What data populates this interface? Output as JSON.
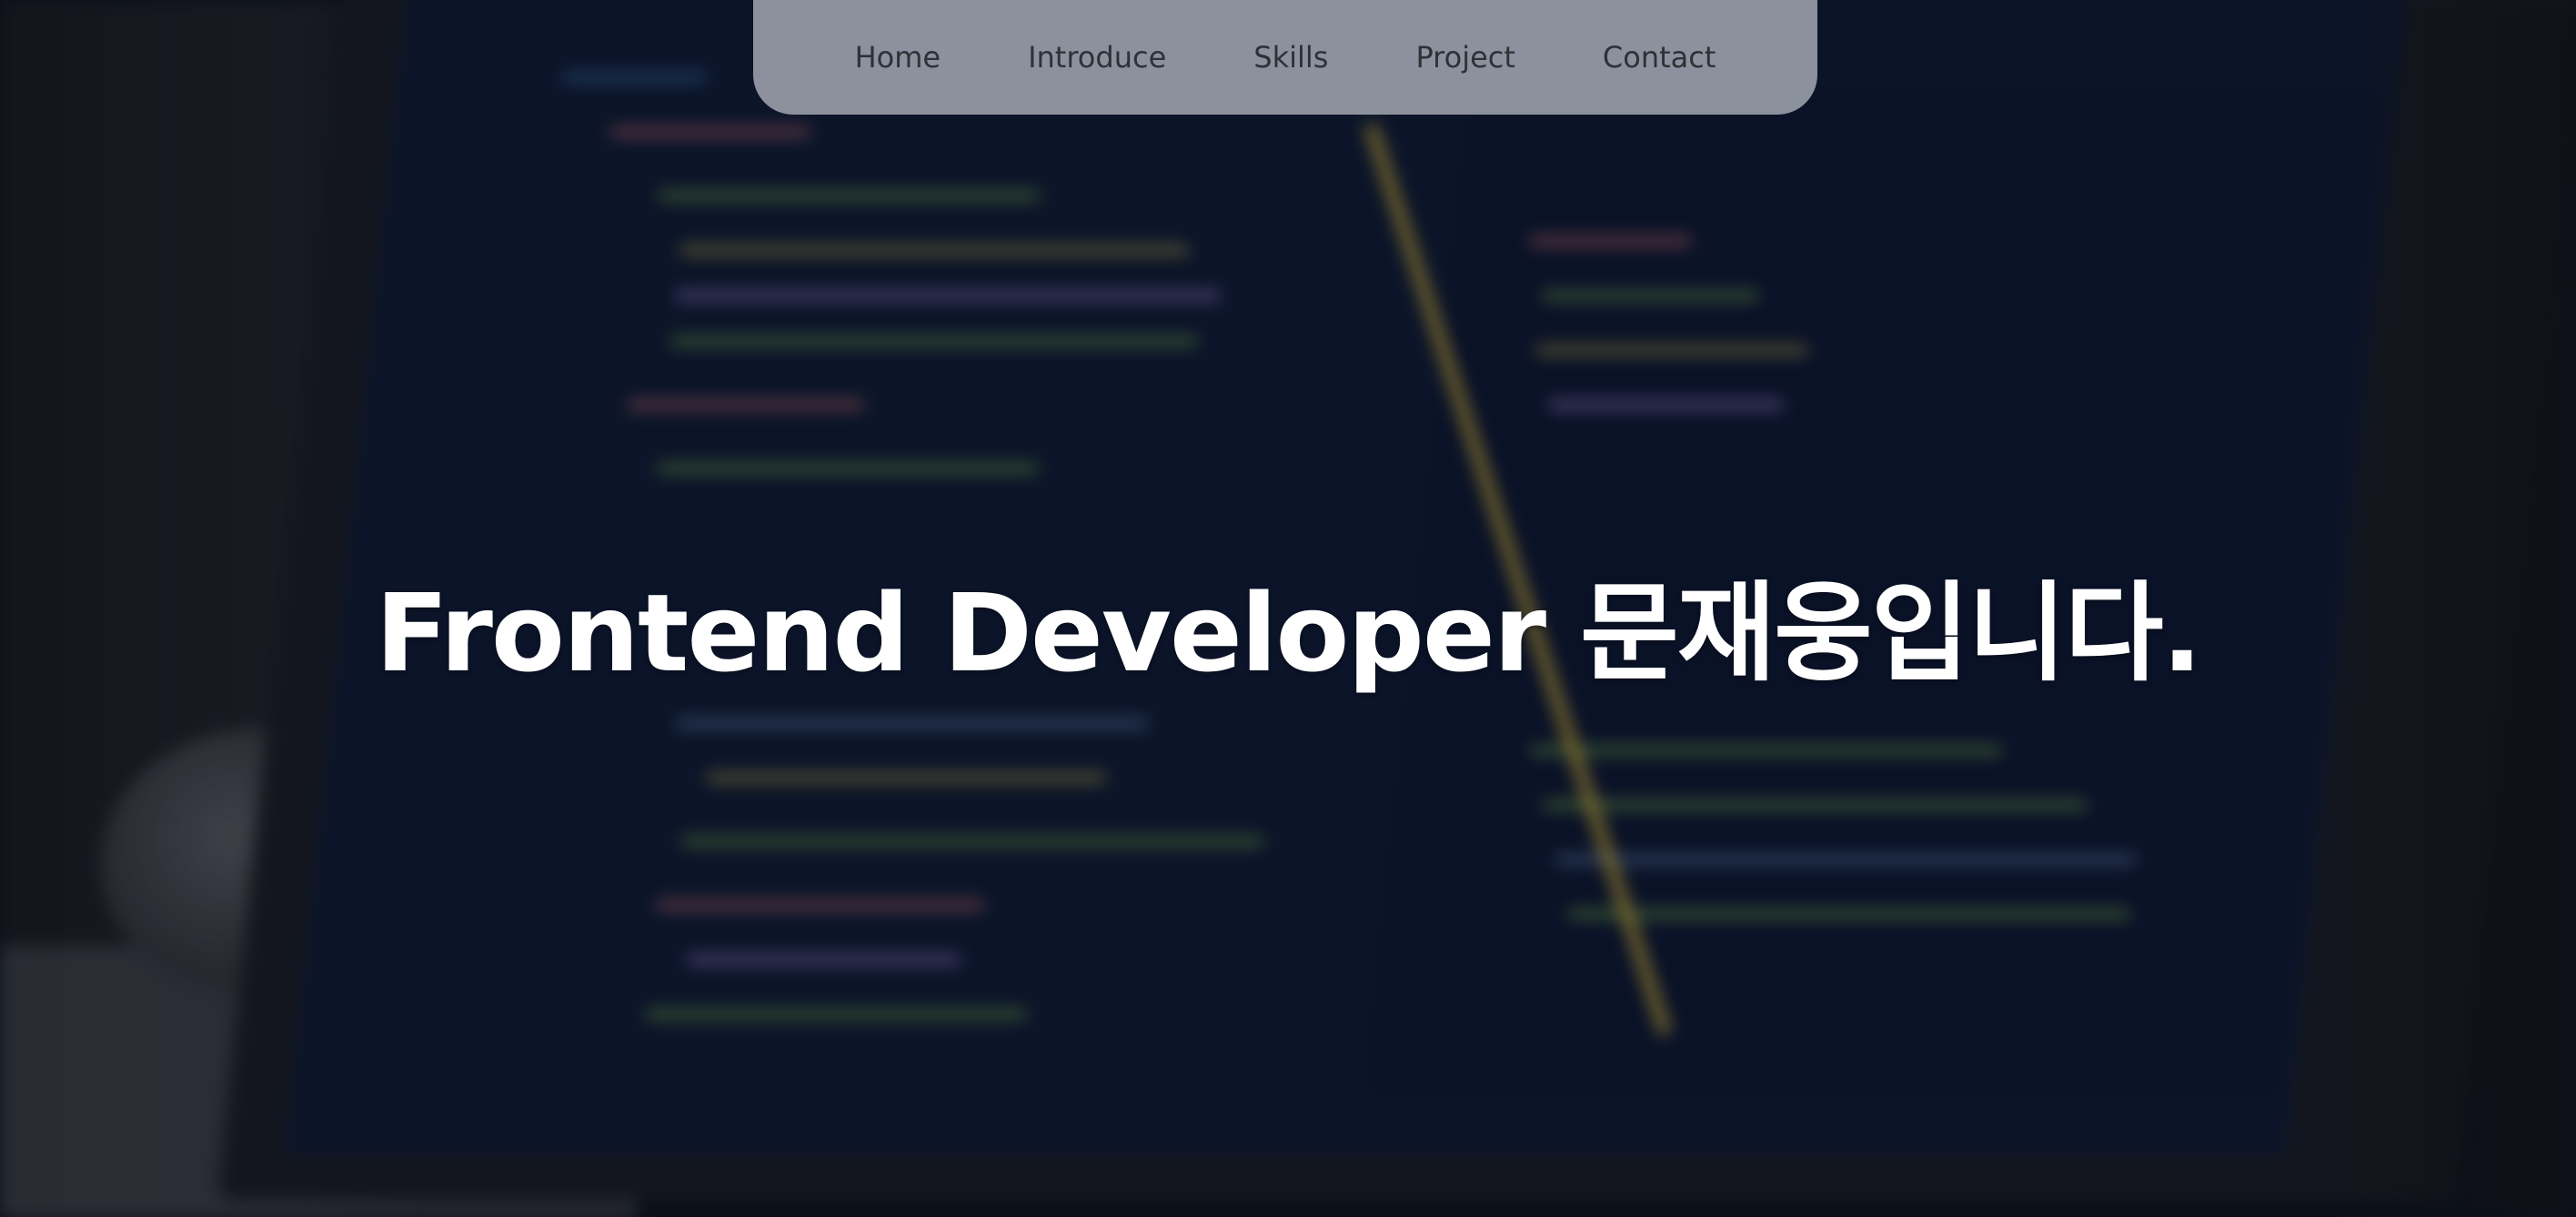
{
  "nav": {
    "items": [
      {
        "label": "Home"
      },
      {
        "label": "Introduce"
      },
      {
        "label": "Skills"
      },
      {
        "label": "Project"
      },
      {
        "label": "Contact"
      }
    ]
  },
  "hero": {
    "headline": "Frontend Developer 문재웅입니다."
  },
  "colors": {
    "nav_background": "#bec2ca",
    "nav_text": "#2e3136",
    "headline_text": "#ffffff",
    "editor_background": "#0d1a33",
    "accent_yellow": "#c9a83a"
  }
}
